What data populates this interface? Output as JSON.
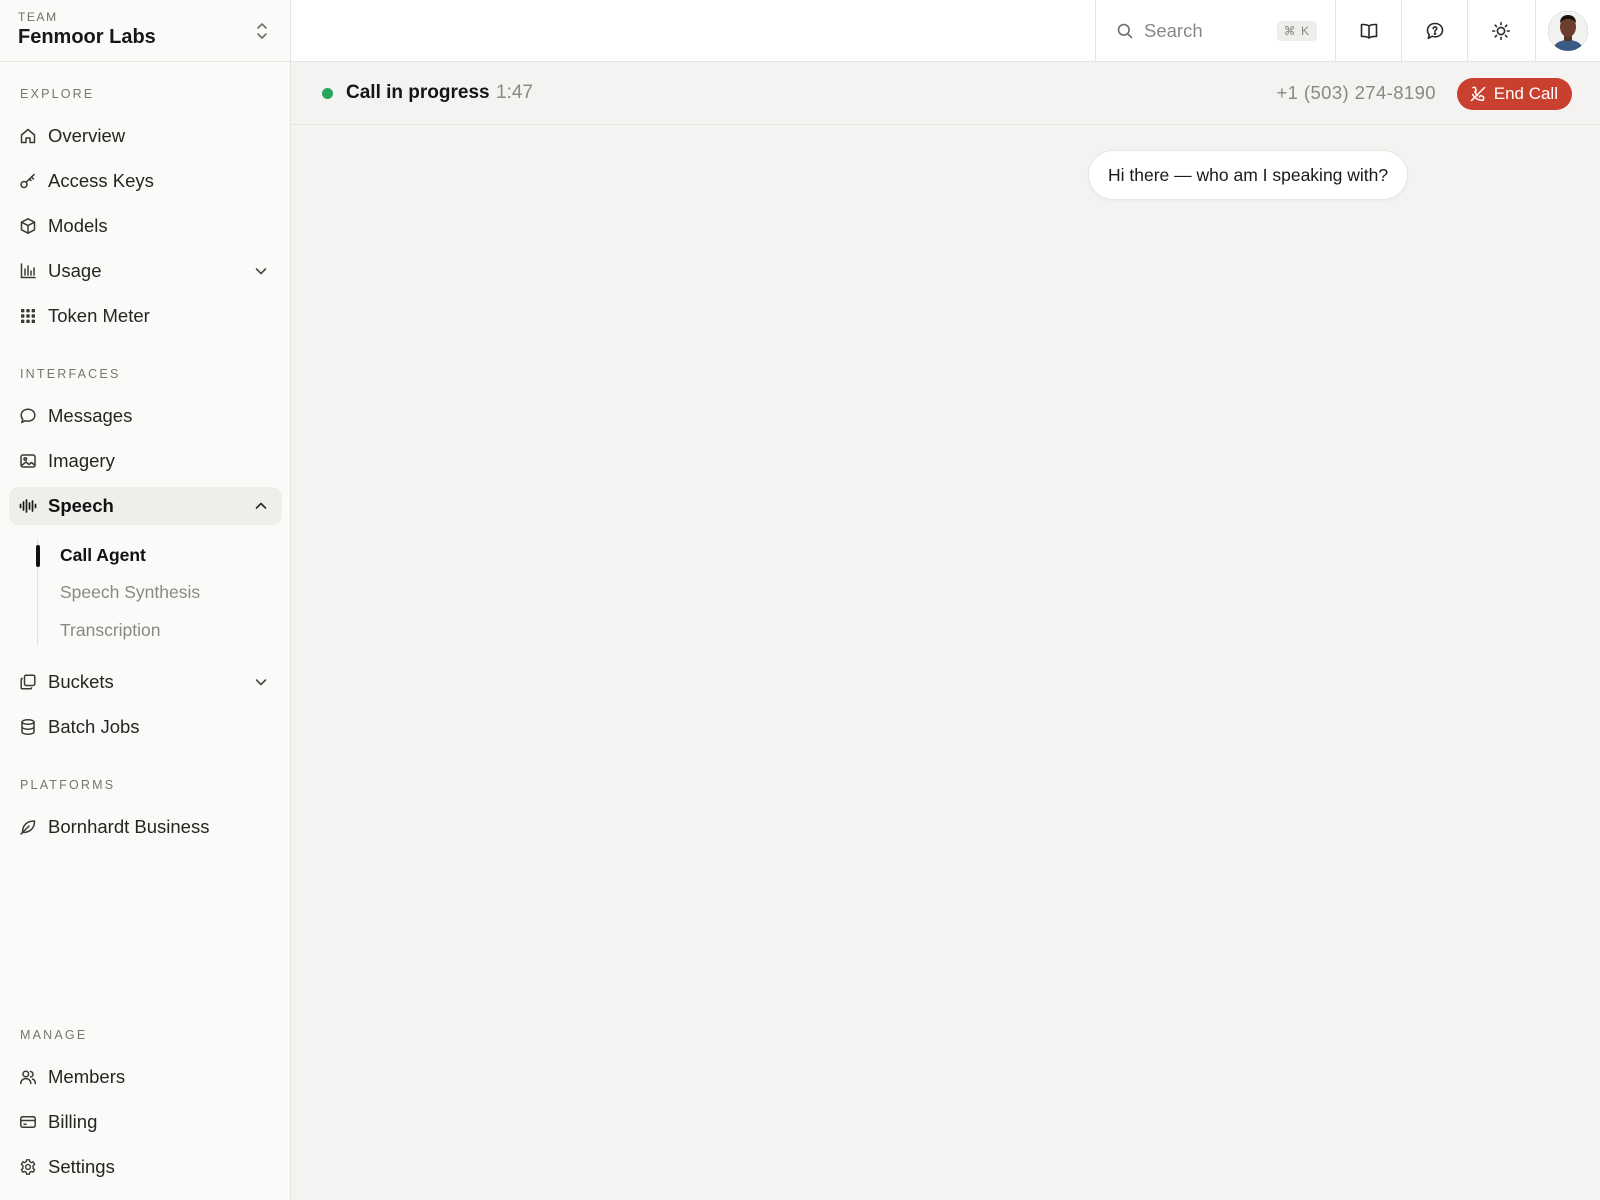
{
  "team": {
    "label": "TEAM",
    "name": "Fenmoor Labs"
  },
  "sidebar": {
    "sections": {
      "explore": "EXPLORE",
      "interfaces": "INTERFACES",
      "platforms": "PLATFORMS",
      "manage": "MANAGE"
    },
    "items": {
      "overview": {
        "label": "Overview",
        "icon": "home-icon"
      },
      "access_keys": {
        "label": "Access Keys",
        "icon": "key-icon"
      },
      "models": {
        "label": "Models",
        "icon": "cube-icon"
      },
      "usage": {
        "label": "Usage",
        "icon": "bar-chart-icon",
        "expanded": false
      },
      "token_meter": {
        "label": "Token Meter",
        "icon": "grid-icon"
      },
      "messages": {
        "label": "Messages",
        "icon": "chat-bubble-icon"
      },
      "imagery": {
        "label": "Imagery",
        "icon": "image-icon"
      },
      "speech": {
        "label": "Speech",
        "icon": "waveform-icon",
        "expanded": true,
        "active": true
      },
      "buckets": {
        "label": "Buckets",
        "icon": "copy-icon",
        "expanded": false
      },
      "batch_jobs": {
        "label": "Batch Jobs",
        "icon": "database-icon"
      },
      "bornhardt": {
        "label": "Bornhardt Business",
        "icon": "leaf-icon"
      },
      "members": {
        "label": "Members",
        "icon": "users-icon"
      },
      "billing": {
        "label": "Billing",
        "icon": "credit-card-icon"
      },
      "settings": {
        "label": "Settings",
        "icon": "gear-icon"
      }
    },
    "speech_sub": [
      "Call Agent",
      "Speech Synthesis",
      "Transcription"
    ],
    "speech_sub_active": "Call Agent"
  },
  "topbar": {
    "search_placeholder": "Search",
    "search_shortcut": "⌘ K",
    "buttons": [
      "book-icon",
      "help-bubble-icon",
      "sun-icon"
    ]
  },
  "call": {
    "status": "Call in progress",
    "duration": "1:47",
    "phone": "+1 (503) 274-8190",
    "end_label": "End Call",
    "status_color": "#27a55d",
    "end_color": "#c9402f"
  },
  "messages": [
    {
      "text": "Hi there — who am I speaking with?"
    }
  ]
}
